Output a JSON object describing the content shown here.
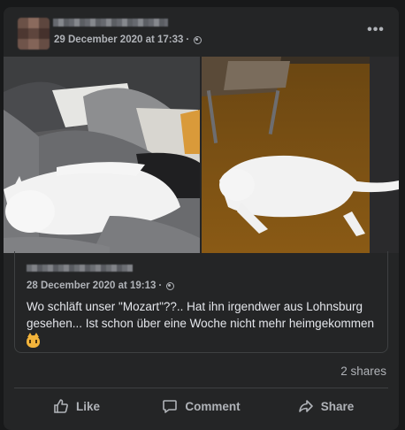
{
  "post": {
    "timestamp": "29 December 2020 at 17:33",
    "separator": "·",
    "privacy_icon": "globe-icon",
    "more_icon": "more-options-icon",
    "more_label": "•••"
  },
  "shared": {
    "timestamp": "28 December 2020 at 19:13",
    "separator": "·",
    "text": "Wo schläft unser \"Mozart\"??.. Hat ihn irgendwer aus Lohnsburg gesehen... Ist schon über eine Woche nicht mehr heimgekommen",
    "emoji_icon": "crying-cat-emoji"
  },
  "stats": {
    "shares": "2 shares"
  },
  "actions": {
    "like": "Like",
    "comment": "Comment",
    "share": "Share"
  },
  "colors": {
    "background": "#18191a",
    "card": "#242526",
    "text_primary": "#e4e6eb",
    "text_secondary": "#b0b3b8",
    "divider": "#3e4042"
  }
}
